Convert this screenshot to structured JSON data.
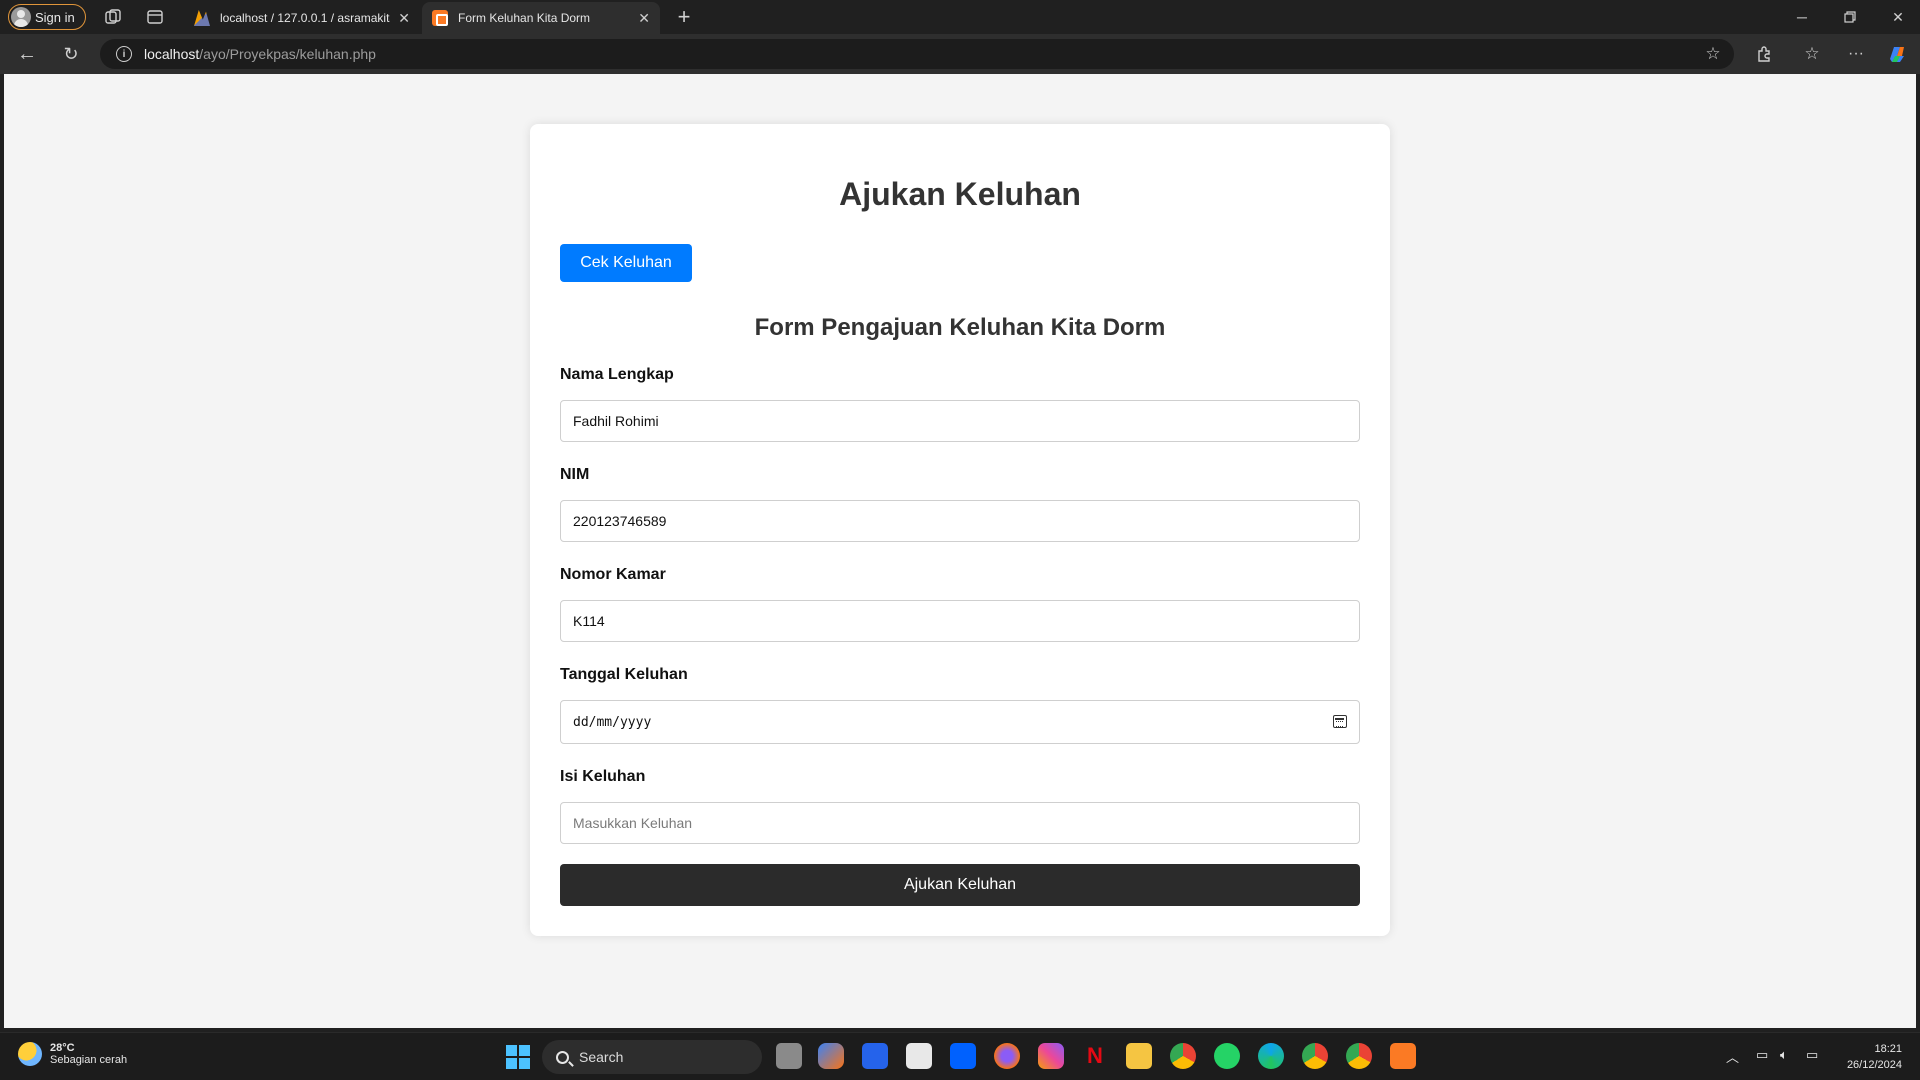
{
  "browser": {
    "signin_label": "Sign in",
    "tabs": [
      {
        "title": "localhost / 127.0.0.1 / asramakita",
        "favicon": "phpmyadmin-icon"
      },
      {
        "title": "Form Keluhan Kita Dorm",
        "favicon": "xampp-icon",
        "active": true
      }
    ],
    "new_tab": "+",
    "url_host": "localhost",
    "url_path": "/ayo/Proyekpas/keluhan.php"
  },
  "page": {
    "title": "Ajukan Keluhan",
    "cek_button": "Cek Keluhan",
    "form_title": "Form Pengajuan Keluhan Kita Dorm",
    "fields": {
      "nama": {
        "label": "Nama Lengkap",
        "value": "Fadhil Rohimi"
      },
      "nim": {
        "label": "NIM",
        "value": "220123746589"
      },
      "kamar": {
        "label": "Nomor Kamar",
        "value": "K114"
      },
      "tanggal": {
        "label": "Tanggal Keluhan",
        "placeholder": "dd/mm/yyyy"
      },
      "isi": {
        "label": "Isi Keluhan",
        "placeholder": "Masukkan Keluhan"
      }
    },
    "submit_button": "Ajukan Keluhan",
    "colors": {
      "primary": "#007bff",
      "submit": "#2b2b2b"
    }
  },
  "taskbar": {
    "weather_temp": "28°C",
    "weather_desc": "Sebagian cerah",
    "search_label": "Search",
    "time": "18:21",
    "date": "26/12/2024"
  }
}
